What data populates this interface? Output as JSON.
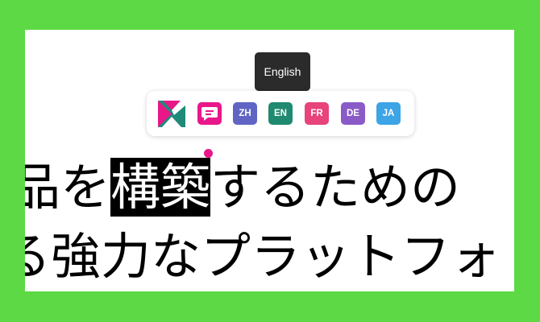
{
  "tooltip": {
    "text": "English"
  },
  "toolbar": {
    "logo_icon": "brand-logo-icon",
    "chat_icon": "chat-bubble-icon",
    "languages": [
      {
        "label": "ZH",
        "color": "#6065c4"
      },
      {
        "label": "EN",
        "color": "#1f8a70"
      },
      {
        "label": "FR",
        "color": "#e8437a"
      },
      {
        "label": "DE",
        "color": "#8a5ac9"
      },
      {
        "label": "JA",
        "color": "#3da4e6"
      }
    ]
  },
  "content": {
    "line1": {
      "before": "品を",
      "selected": "構築",
      "after": "するための"
    },
    "line2": {
      "text": "る強力なプラットフォ"
    }
  },
  "colors": {
    "accent": "#e8178a",
    "background": "#5cd944"
  }
}
